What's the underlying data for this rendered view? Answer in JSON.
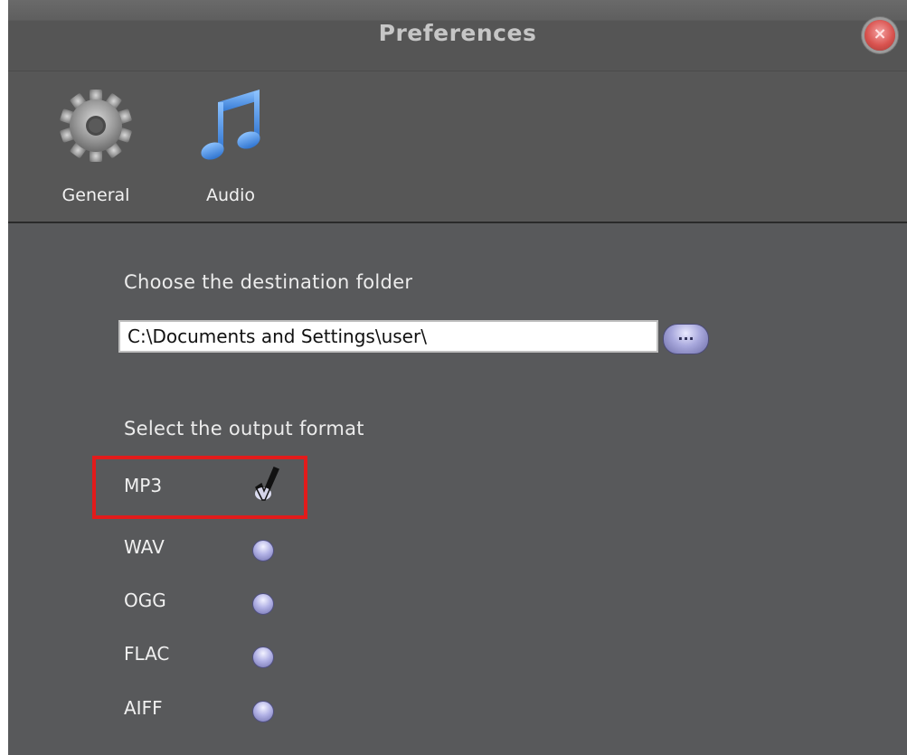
{
  "window": {
    "title": "Preferences"
  },
  "toolbar": {
    "items": [
      {
        "label": "General",
        "icon": "gear-icon",
        "color": "#9a9a9a"
      },
      {
        "label": "Audio",
        "icon": "music-note-icon",
        "color": "#3b86e3"
      }
    ]
  },
  "destination": {
    "heading": "Choose the destination folder",
    "path_value": "C:\\Documents and Settings\\user\\",
    "browse_label": "..."
  },
  "output_format": {
    "heading": "Select the output format",
    "options": [
      {
        "label": "MP3",
        "selected": true
      },
      {
        "label": "WAV",
        "selected": false
      },
      {
        "label": "OGG",
        "selected": false
      },
      {
        "label": "FLAC",
        "selected": false
      },
      {
        "label": "AIFF",
        "selected": false
      }
    ]
  },
  "colors": {
    "background": "#58595b",
    "highlight": "#e21b1b",
    "radio": "#a9a9dd",
    "close_button": "#d9534f"
  }
}
